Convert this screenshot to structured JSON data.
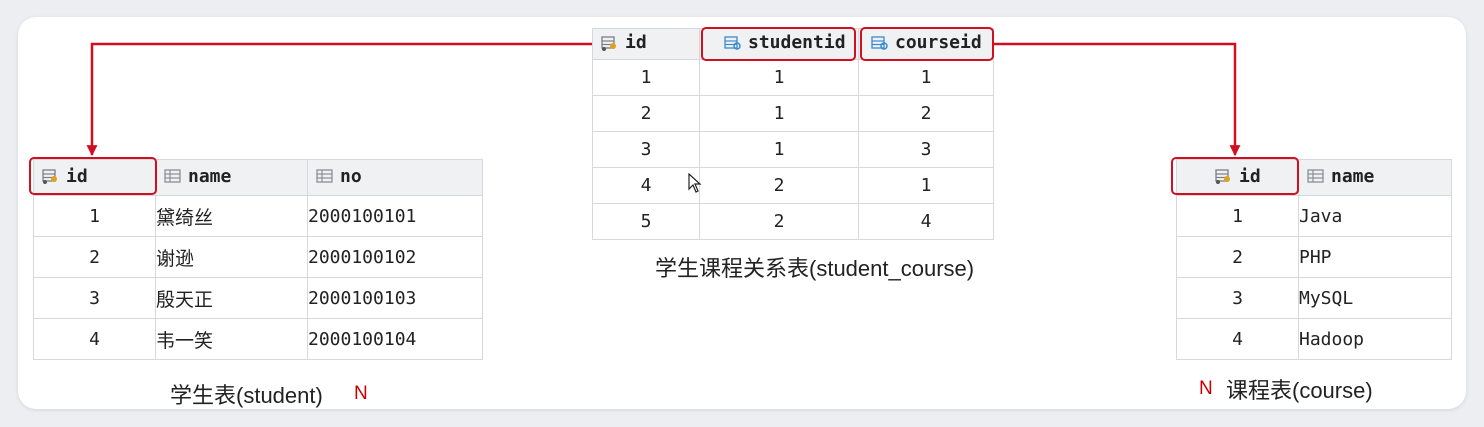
{
  "student": {
    "columns": [
      "id",
      "name",
      "no"
    ],
    "rows": [
      [
        "1",
        "黛绮丝",
        "2000100101"
      ],
      [
        "2",
        "谢逊",
        "2000100102"
      ],
      [
        "3",
        "殷天正",
        "2000100103"
      ],
      [
        "4",
        "韦一笑",
        "2000100104"
      ]
    ],
    "caption": "学生表(student)",
    "cardinality": "N"
  },
  "student_course": {
    "columns": [
      "id",
      "studentid",
      "courseid"
    ],
    "rows": [
      [
        "1",
        "1",
        "1"
      ],
      [
        "2",
        "1",
        "2"
      ],
      [
        "3",
        "1",
        "3"
      ],
      [
        "4",
        "2",
        "1"
      ],
      [
        "5",
        "2",
        "4"
      ]
    ],
    "caption": "学生课程关系表(student_course)"
  },
  "course": {
    "columns": [
      "id",
      "name"
    ],
    "rows": [
      [
        "1",
        "Java"
      ],
      [
        "2",
        "PHP"
      ],
      [
        "3",
        "MySQL"
      ],
      [
        "4",
        "Hadoop"
      ]
    ],
    "caption": "课程表(course)",
    "cardinality": "N"
  },
  "colors": {
    "highlight": "#d01020",
    "arrow": "#d01020",
    "n_mark": "#cc0000"
  },
  "icons": {
    "primary_key": "key-column-icon",
    "column": "table-column-icon",
    "foreign_key": "foreign-key-icon"
  }
}
